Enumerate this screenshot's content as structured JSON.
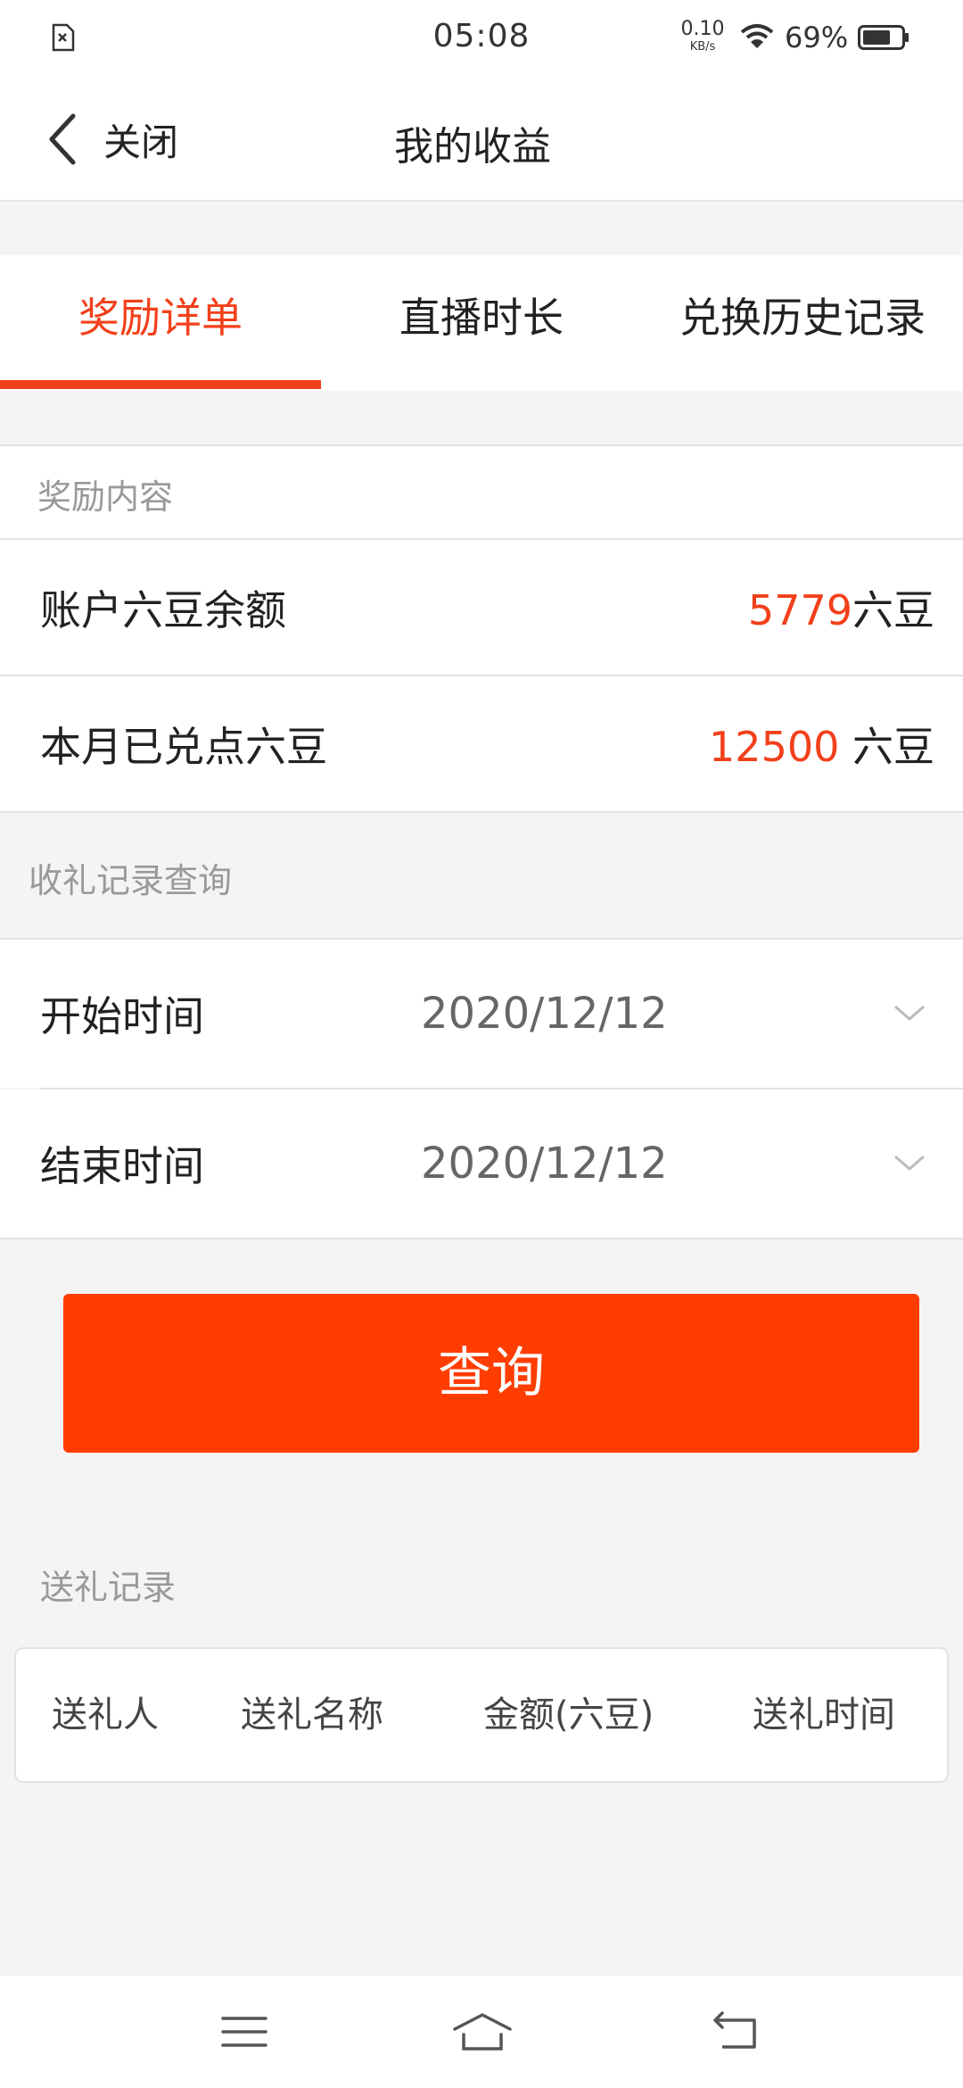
{
  "status_bar": {
    "time": "05:08",
    "net_speed_value": "0.10",
    "net_speed_unit": "KB/s",
    "battery": "69%",
    "left_icon": "sim-card-off-icon",
    "wifi_icon": "wifi-icon",
    "battery_icon": "battery-icon"
  },
  "nav": {
    "back_label": "关闭",
    "title": "我的收益"
  },
  "tabs": [
    {
      "label": "奖励详单",
      "active": true
    },
    {
      "label": "直播时长",
      "active": false
    },
    {
      "label": "兑换历史记录",
      "active": false
    }
  ],
  "reward": {
    "section_label": "奖励内容",
    "balance_label": "账户六豆余额",
    "balance_value": "5779",
    "balance_unit": "六豆",
    "monthly_label": "本月已兑点六豆",
    "monthly_value": "12500",
    "monthly_unit": " 六豆"
  },
  "query": {
    "section_label": "收礼记录查询",
    "start_label": "开始时间",
    "start_date": "2020/12/12",
    "end_label": "结束时间",
    "end_date": "2020/12/12",
    "button_label": "查询"
  },
  "records": {
    "section_label": "送礼记录",
    "columns": [
      "送礼人",
      "送礼名称",
      "金额(六豆)",
      "送礼时间"
    ]
  },
  "colors": {
    "accent": "#f2401a",
    "button": "#ff3d00",
    "background": "#f4f4f4"
  }
}
